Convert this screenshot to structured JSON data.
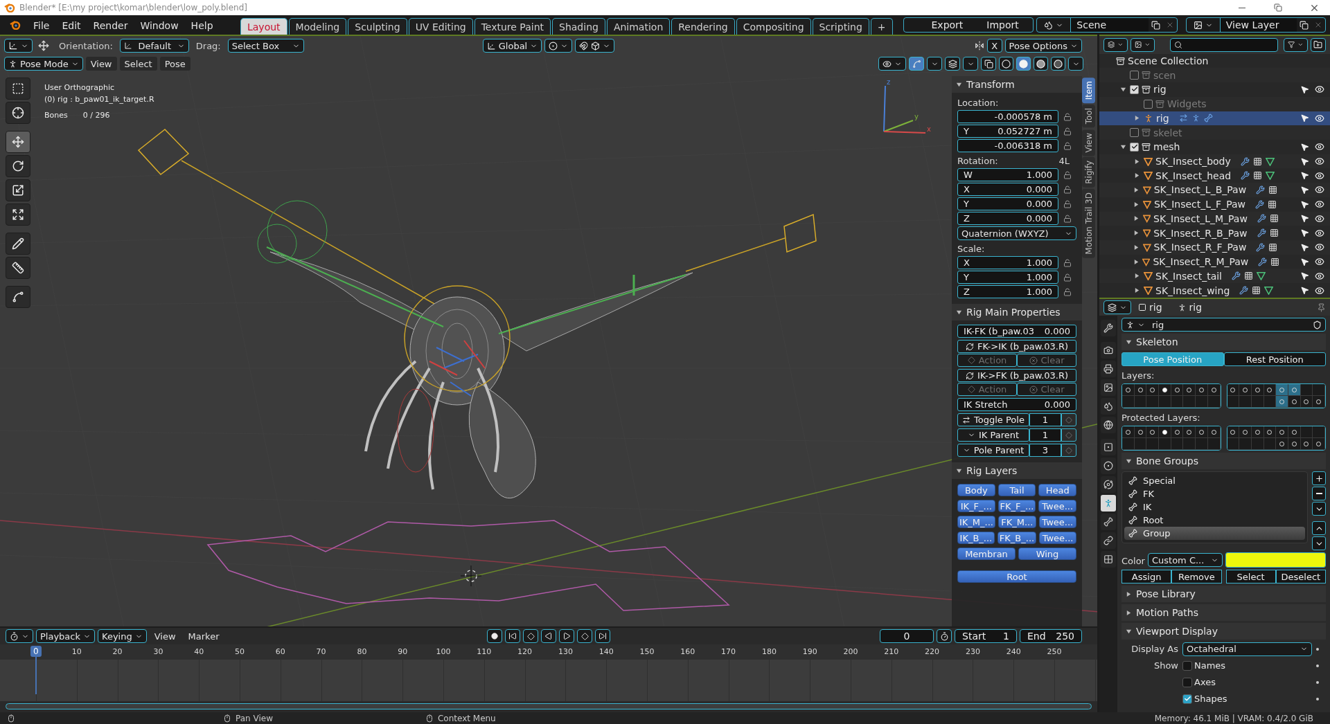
{
  "title_bar": {
    "title": "Blender* [E:\\my project\\komar\\blender\\low_poly.blend]"
  },
  "menu": [
    "File",
    "Edit",
    "Render",
    "Window",
    "Help"
  ],
  "workspaces": [
    {
      "label": "Layout",
      "selected": true
    },
    {
      "label": "Modeling",
      "selected": false
    },
    {
      "label": "Sculpting",
      "selected": false
    },
    {
      "label": "UV Editing",
      "selected": false
    },
    {
      "label": "Texture Paint",
      "selected": false
    },
    {
      "label": "Shading",
      "selected": false
    },
    {
      "label": "Animation",
      "selected": false
    },
    {
      "label": "Rendering",
      "selected": false
    },
    {
      "label": "Compositing",
      "selected": false
    },
    {
      "label": "Scripting",
      "selected": false
    }
  ],
  "add_workspace": "+",
  "export_import": [
    "Export",
    "Import"
  ],
  "scene": "Scene",
  "view_layer": "View Layer",
  "viewport": {
    "orientation_label": "Orientation:",
    "orientation": "Default",
    "drag_label": "Drag:",
    "drag": "Select Box",
    "transform_orientation": "Global",
    "mirror_axis": "X",
    "pose_options": "Pose Options",
    "mode": "Pose Mode",
    "mode_menus": [
      "View",
      "Select",
      "Pose"
    ],
    "shading": [
      {
        "kind": "wireframe",
        "selected": false
      },
      {
        "kind": "solid",
        "selected": true
      },
      {
        "kind": "material",
        "selected": false
      },
      {
        "kind": "rendered",
        "selected": false
      }
    ],
    "view_name": "User Orthographic",
    "object_info": "(0) rig : b_paw01_ik_target.R",
    "stats_label": "Bones",
    "stats_value": "0 / 296",
    "gizmo_axes": [
      "z",
      "y",
      "x"
    ],
    "tools": [
      {
        "kind": "select_box",
        "selected": false
      },
      {
        "kind": "cursor",
        "selected": false
      },
      {
        "kind": "move",
        "selected": true
      },
      {
        "kind": "rotate",
        "selected": false
      },
      {
        "kind": "scale",
        "selected": false
      },
      {
        "kind": "transform",
        "selected": false
      },
      {
        "kind": "annotate",
        "selected": false
      },
      {
        "kind": "measure",
        "selected": false
      },
      {
        "kind": "curve",
        "selected": false
      }
    ]
  },
  "sidebar": {
    "tabs": [
      {
        "label": "Item",
        "selected": true
      },
      {
        "label": "Tool",
        "selected": false
      },
      {
        "label": "View",
        "selected": false
      },
      {
        "label": "Rigify",
        "selected": false
      },
      {
        "label": "Motion Trail 3D",
        "selected": false
      }
    ],
    "transform": {
      "title": "Transform",
      "expanded": true,
      "location_label": "Location:",
      "location": [
        {
          "value": "-0.000578 m"
        },
        {
          "axis": "Y",
          "value": "0.052727 m"
        },
        {
          "value": "-0.006318 m"
        }
      ],
      "rotation_label": "Rotation:",
      "rotation_lock": "4L",
      "rotation": [
        {
          "axis": "W",
          "value": "1.000"
        },
        {
          "axis": "X",
          "value": "0.000"
        },
        {
          "axis": "Y",
          "value": "0.000"
        },
        {
          "axis": "Z",
          "value": "0.000"
        }
      ],
      "rotation_mode": "Quaternion (WXYZ)",
      "scale_label": "Scale:",
      "scale": [
        {
          "axis": "X",
          "value": "1.000"
        },
        {
          "axis": "Y",
          "value": "1.000"
        },
        {
          "axis": "Z",
          "value": "1.000"
        }
      ]
    },
    "rig_main": {
      "title": "Rig Main Properties",
      "expanded": true,
      "rows": [
        {
          "kind": "slider",
          "label": "IK-FK (b_paw.03",
          "value": "0.000",
          "disabled": false
        },
        {
          "kind": "operator",
          "label": "FK->IK (b_paw.03.R)",
          "disabled": false
        },
        {
          "kind": "pair",
          "buttons": [
            "Action",
            "Clear"
          ],
          "disabled": true
        },
        {
          "kind": "operator",
          "label": "IK->FK (b_paw.03.R)",
          "disabled": false
        },
        {
          "kind": "pair",
          "buttons": [
            "Action",
            "Clear"
          ],
          "disabled": true
        },
        {
          "kind": "slider",
          "label": "IK Stretch",
          "value": "0.000",
          "disabled": false
        },
        {
          "kind": "number",
          "label": "Toggle Pole",
          "value": "1",
          "disabled": false
        },
        {
          "kind": "enum",
          "label": "IK Parent",
          "value": "1",
          "disabled": false
        },
        {
          "kind": "enum",
          "label": "Pole Parent",
          "value": "3",
          "disabled": false
        }
      ]
    },
    "rig_layers": {
      "title": "Rig Layers",
      "expanded": true,
      "grid": [
        [
          {
            "label": "Body",
            "selected": true
          },
          {
            "label": "Tail",
            "selected": true
          },
          {
            "label": "Head",
            "selected": true
          }
        ],
        [
          {
            "label": "IK_F_...",
            "selected": true
          },
          {
            "label": "FK_F_...",
            "selected": true
          },
          {
            "label": "Twee...",
            "selected": true
          }
        ],
        [
          {
            "label": "IK_M_...",
            "selected": true
          },
          {
            "label": "FK_M...",
            "selected": true
          },
          {
            "label": "Twee...",
            "selected": true
          }
        ],
        [
          {
            "label": "IK_B_...",
            "selected": true
          },
          {
            "label": "FK_B_...",
            "selected": true
          },
          {
            "label": "Twee...",
            "selected": true
          }
        ]
      ],
      "pair": [
        {
          "label": "Membran",
          "selected": true
        },
        {
          "label": "Wing",
          "selected": true
        }
      ],
      "root": {
        "label": "Root",
        "selected": true
      }
    }
  },
  "outliner": {
    "tree": [
      {
        "label": "Scene Collection",
        "kind": "scene_collection",
        "selected": false,
        "children": [
          {
            "label": "scen",
            "kind": "collection",
            "checked": false,
            "selected": false
          },
          {
            "label": "rig",
            "kind": "collection",
            "checked": true,
            "expanded": true,
            "selected": false,
            "children": [
              {
                "label": "Widgets",
                "kind": "collection",
                "checked": false,
                "selected": false
              },
              {
                "label": "rig",
                "kind": "armature",
                "expanded": false,
                "selected": true
              }
            ]
          },
          {
            "label": "skelet",
            "kind": "collection",
            "checked": false,
            "selected": false
          },
          {
            "label": "mesh",
            "kind": "collection",
            "checked": true,
            "expanded": true,
            "selected": false,
            "children": [
              {
                "label": "SK_Insect_body",
                "kind": "mesh",
                "expanded": false,
                "data_icon": true,
                "selected": false
              },
              {
                "label": "SK_Insect_head",
                "kind": "mesh",
                "expanded": false,
                "data_icon": true,
                "selected": false
              },
              {
                "label": "SK_Insect_L_B_Paw",
                "kind": "mesh",
                "expanded": false,
                "data_icon": false,
                "selected": false
              },
              {
                "label": "SK_Insect_L_F_Paw",
                "kind": "mesh",
                "expanded": false,
                "data_icon": false,
                "selected": false
              },
              {
                "label": "SK_Insect_L_M_Paw",
                "kind": "mesh",
                "expanded": false,
                "data_icon": false,
                "selected": false
              },
              {
                "label": "SK_Insect_R_B_Paw",
                "kind": "mesh",
                "expanded": false,
                "data_icon": false,
                "selected": false
              },
              {
                "label": "SK_Insect_R_F_Paw",
                "kind": "mesh",
                "expanded": false,
                "data_icon": false,
                "selected": false
              },
              {
                "label": "SK_Insect_R_M_Paw",
                "kind": "mesh",
                "expanded": false,
                "data_icon": false,
                "selected": false
              },
              {
                "label": "SK_Insect_tail",
                "kind": "mesh",
                "expanded": false,
                "data_icon": true,
                "selected": false
              },
              {
                "label": "SK_Insect_wing",
                "kind": "mesh",
                "expanded": false,
                "data_icon": true,
                "selected": false
              }
            ]
          }
        ]
      }
    ]
  },
  "properties": {
    "breadcrumbs": [
      "rig",
      "rig"
    ],
    "tabs": [
      {
        "kind": "tool",
        "selected": false
      },
      {
        "kind": "render",
        "selected": false
      },
      {
        "kind": "output",
        "selected": false
      },
      {
        "kind": "view_layer",
        "selected": false
      },
      {
        "kind": "scene",
        "selected": false
      },
      {
        "kind": "world",
        "selected": false
      },
      {
        "kind": "object",
        "selected": false
      },
      {
        "kind": "physics",
        "selected": false
      },
      {
        "kind": "constraints",
        "selected": false
      },
      {
        "kind": "data",
        "selected": true
      },
      {
        "kind": "bone",
        "selected": false
      },
      {
        "kind": "bone_constraints",
        "selected": false
      },
      {
        "kind": "texture",
        "selected": false
      }
    ],
    "datablock": "rig",
    "skeleton": {
      "title": "Skeleton",
      "expanded": true,
      "pose_modes": [
        {
          "label": "Pose Position",
          "selected": true
        },
        {
          "label": "Rest Position",
          "selected": false
        }
      ],
      "layers_label": "Layers:",
      "layers": [
        [
          [
            {
              "kind": "dot",
              "on": false
            },
            {
              "kind": "dot",
              "on": false
            },
            {
              "kind": "dot",
              "on": false
            },
            {
              "kind": "filled",
              "on": false
            },
            {
              "kind": "dot",
              "on": false
            },
            {
              "kind": "dot",
              "on": false
            },
            {
              "kind": "dot",
              "on": false
            },
            {
              "kind": "dot",
              "on": false
            }
          ],
          [
            {
              "kind": "empty",
              "on": false
            },
            {
              "kind": "empty",
              "on": false
            },
            {
              "kind": "empty",
              "on": false
            },
            {
              "kind": "empty",
              "on": false
            },
            {
              "kind": "empty",
              "on": false
            },
            {
              "kind": "empty",
              "on": false
            },
            {
              "kind": "empty",
              "on": false
            },
            {
              "kind": "empty",
              "on": false
            }
          ]
        ],
        [
          [
            {
              "kind": "dot",
              "on": false
            },
            {
              "kind": "dot",
              "on": false
            },
            {
              "kind": "dot",
              "on": false
            },
            {
              "kind": "dot",
              "on": false
            },
            {
              "kind": "dot",
              "on": true
            },
            {
              "kind": "dot",
              "on": true
            },
            {
              "kind": "empty",
              "on": false
            },
            {
              "kind": "empty",
              "on": false
            }
          ],
          [
            {
              "kind": "empty",
              "on": false
            },
            {
              "kind": "empty",
              "on": false
            },
            {
              "kind": "empty",
              "on": false
            },
            {
              "kind": "empty",
              "on": false
            },
            {
              "kind": "dot",
              "on": true
            },
            {
              "kind": "dot",
              "on": false
            },
            {
              "kind": "dot",
              "on": false
            },
            {
              "kind": "dot",
              "on": false
            }
          ]
        ]
      ],
      "protected_label": "Protected Layers:",
      "protected_layers": [
        [
          [
            {
              "kind": "dot",
              "on": false
            },
            {
              "kind": "dot",
              "on": false
            },
            {
              "kind": "dot",
              "on": false
            },
            {
              "kind": "filled",
              "on": false
            },
            {
              "kind": "dot",
              "on": false
            },
            {
              "kind": "dot",
              "on": false
            },
            {
              "kind": "dot",
              "on": false
            },
            {
              "kind": "dot",
              "on": false
            }
          ],
          [
            {
              "kind": "empty",
              "on": false
            },
            {
              "kind": "empty",
              "on": false
            },
            {
              "kind": "empty",
              "on": false
            },
            {
              "kind": "empty",
              "on": false
            },
            {
              "kind": "empty",
              "on": false
            },
            {
              "kind": "empty",
              "on": false
            },
            {
              "kind": "empty",
              "on": false
            },
            {
              "kind": "empty",
              "on": false
            }
          ]
        ],
        [
          [
            {
              "kind": "dot",
              "on": false
            },
            {
              "kind": "dot",
              "on": false
            },
            {
              "kind": "dot",
              "on": false
            },
            {
              "kind": "dot",
              "on": false
            },
            {
              "kind": "dot",
              "on": false
            },
            {
              "kind": "dot",
              "on": false
            },
            {
              "kind": "empty",
              "on": false
            },
            {
              "kind": "empty",
              "on": false
            }
          ],
          [
            {
              "kind": "empty",
              "on": false
            },
            {
              "kind": "empty",
              "on": false
            },
            {
              "kind": "empty",
              "on": false
            },
            {
              "kind": "empty",
              "on": false
            },
            {
              "kind": "dot",
              "on": false
            },
            {
              "kind": "dot",
              "on": false
            },
            {
              "kind": "dot",
              "on": false
            },
            {
              "kind": "dot",
              "on": false
            }
          ]
        ]
      ]
    },
    "bone_groups": {
      "title": "Bone Groups",
      "expanded": true,
      "groups": [
        {
          "label": "Special",
          "selected": false
        },
        {
          "label": "FK",
          "selected": false
        },
        {
          "label": "IK",
          "selected": false
        },
        {
          "label": "Root",
          "selected": false
        },
        {
          "label": "Group",
          "selected": true
        }
      ],
      "color_label": "Color",
      "color_set": "Custom C...",
      "swatches": [
        {
          "color": "#eef70c"
        },
        {
          "color": "#eef70c"
        },
        {
          "color": "#eef70c"
        }
      ],
      "buttons": [
        "Assign",
        "Remove",
        "Select",
        "Deselect"
      ]
    },
    "collapsed_panels": [
      {
        "title": "Pose Library",
        "expanded": false
      },
      {
        "title": "Motion Paths",
        "expanded": false
      }
    ],
    "viewport_display": {
      "title": "Viewport Display",
      "expanded": true,
      "display_as_label": "Display As",
      "display_as": "Octahedral",
      "show_label": "Show",
      "options": [
        {
          "label": "Names",
          "checked": false
        },
        {
          "label": "Axes",
          "checked": false
        },
        {
          "label": "Shapes",
          "checked": true
        }
      ]
    }
  },
  "timeline": {
    "menus": [
      {
        "label": "Playback",
        "kind": "dropdown"
      },
      {
        "label": "Keying",
        "kind": "dropdown"
      },
      {
        "label": "View",
        "kind": "menu"
      },
      {
        "label": "Marker",
        "kind": "menu"
      }
    ],
    "current_frame": "0",
    "start_label": "Start",
    "start": "1",
    "end_label": "End",
    "end": "250",
    "playhead": "0",
    "ticks": [
      "10",
      "20",
      "30",
      "40",
      "50",
      "60",
      "70",
      "80",
      "90",
      "100",
      "110",
      "120",
      "130",
      "140",
      "150",
      "160",
      "170",
      "180",
      "190",
      "200",
      "210",
      "220",
      "230",
      "240",
      "250"
    ]
  },
  "status_bar": {
    "hints": [
      "Pan View",
      "Context Menu"
    ],
    "memory": "Memory: 46.1 MiB | VRAM: 0.4/2.0 GiB"
  }
}
